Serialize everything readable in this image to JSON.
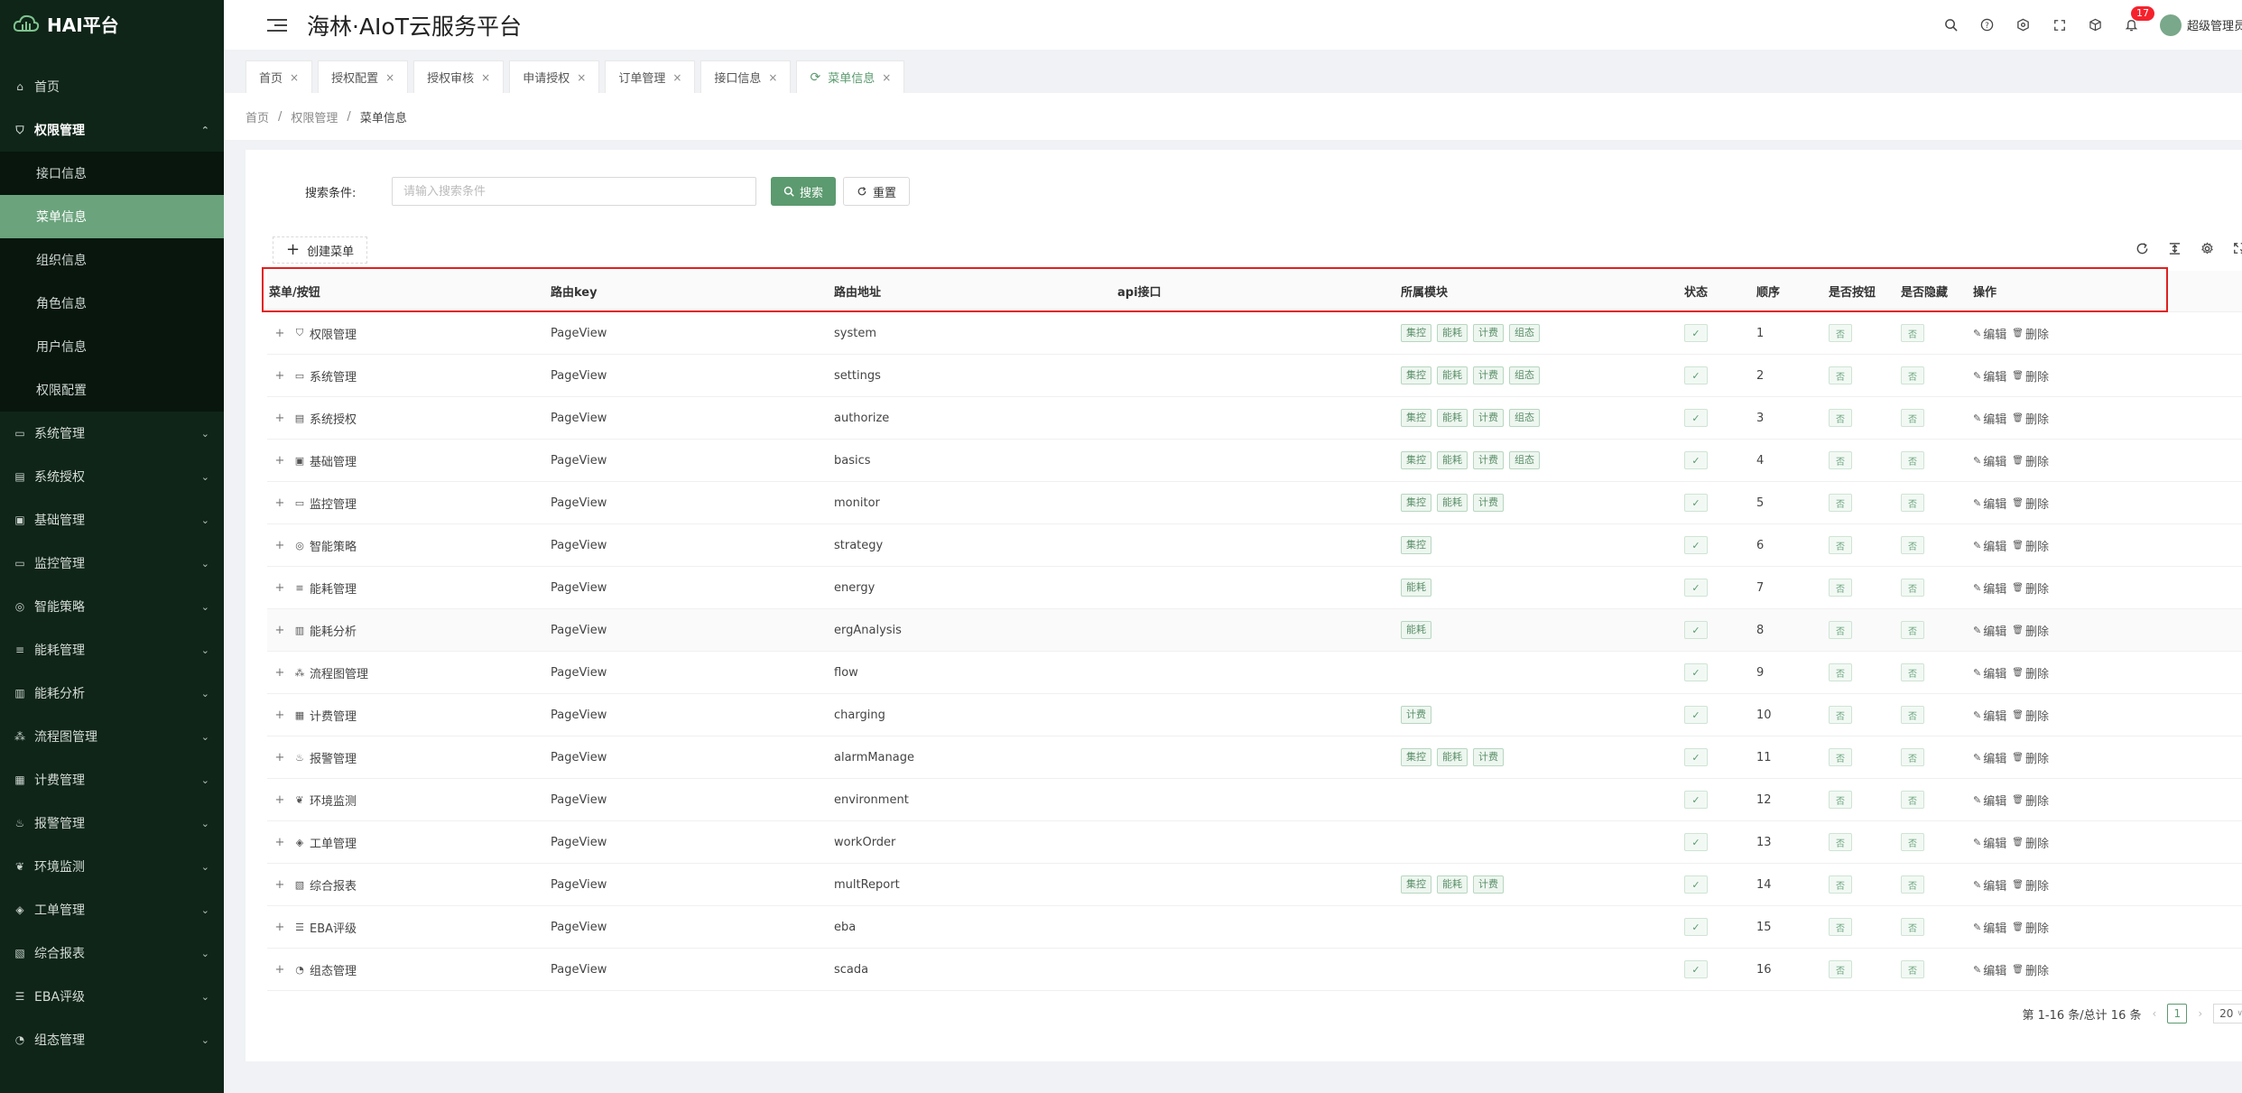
{
  "brand": {
    "title": "HAI平台"
  },
  "header": {
    "title": "海林·AIoT云服务平台",
    "notification_count": "17",
    "user_name": "超级管理员"
  },
  "sidebar": {
    "items": [
      {
        "label": "首页",
        "icon": "home-icon",
        "expandable": false
      },
      {
        "label": "权限管理",
        "icon": "shield-icon",
        "expandable": true,
        "expanded": true,
        "children": [
          {
            "label": "接口信息",
            "selected": false
          },
          {
            "label": "菜单信息",
            "selected": true
          },
          {
            "label": "组织信息",
            "selected": false
          },
          {
            "label": "角色信息",
            "selected": false
          },
          {
            "label": "用户信息",
            "selected": false
          },
          {
            "label": "权限配置",
            "selected": false
          }
        ]
      },
      {
        "label": "系统管理",
        "icon": "monitor-icon",
        "expandable": true
      },
      {
        "label": "系统授权",
        "icon": "document-icon",
        "expandable": true
      },
      {
        "label": "基础管理",
        "icon": "layout-icon",
        "expandable": true
      },
      {
        "label": "监控管理",
        "icon": "monitor-icon",
        "expandable": true
      },
      {
        "label": "智能策略",
        "icon": "bulb-icon",
        "expandable": true
      },
      {
        "label": "能耗管理",
        "icon": "sliders-icon",
        "expandable": true
      },
      {
        "label": "能耗分析",
        "icon": "bar-chart-icon",
        "expandable": true
      },
      {
        "label": "流程图管理",
        "icon": "flow-icon",
        "expandable": true
      },
      {
        "label": "计费管理",
        "icon": "money-icon",
        "expandable": true
      },
      {
        "label": "报警管理",
        "icon": "alarm-icon",
        "expandable": true
      },
      {
        "label": "环境监测",
        "icon": "leaf-icon",
        "expandable": true
      },
      {
        "label": "工单管理",
        "icon": "stack-icon",
        "expandable": true
      },
      {
        "label": "综合报表",
        "icon": "report-icon",
        "expandable": true
      },
      {
        "label": "EBA评级",
        "icon": "list-icon",
        "expandable": true
      },
      {
        "label": "组态管理",
        "icon": "dashboard-icon",
        "expandable": true
      }
    ]
  },
  "tabs": [
    {
      "label": "首页",
      "active": false
    },
    {
      "label": "授权配置",
      "active": false
    },
    {
      "label": "授权审核",
      "active": false
    },
    {
      "label": "申请授权",
      "active": false
    },
    {
      "label": "订单管理",
      "active": false
    },
    {
      "label": "接口信息",
      "active": false
    },
    {
      "label": "菜单信息",
      "active": true
    }
  ],
  "breadcrumb": [
    "首页",
    "权限管理",
    "菜单信息"
  ],
  "search": {
    "label": "搜索条件:",
    "placeholder": "请输入搜索条件",
    "value": "",
    "search_label": "搜索",
    "reset_label": "重置"
  },
  "toolbar": {
    "create_label": "创建菜单"
  },
  "table": {
    "columns": [
      "菜单/按钮",
      "路由key",
      "路由地址",
      "api接口",
      "所属模块",
      "状态",
      "顺序",
      "是否按钮",
      "是否隐藏",
      "操作"
    ],
    "edit_label": "编辑",
    "delete_label": "删除",
    "no_label": "否",
    "status_mark": "✓",
    "rows": [
      {
        "name": "权限管理",
        "icon": "shield-icon",
        "key": "PageView",
        "path": "system",
        "api": "",
        "modules": [
          "集控",
          "能耗",
          "计费",
          "组态"
        ],
        "order": "1"
      },
      {
        "name": "系统管理",
        "icon": "monitor-icon",
        "key": "PageView",
        "path": "settings",
        "api": "",
        "modules": [
          "集控",
          "能耗",
          "计费",
          "组态"
        ],
        "order": "2"
      },
      {
        "name": "系统授权",
        "icon": "document-icon",
        "key": "PageView",
        "path": "authorize",
        "api": "",
        "modules": [
          "集控",
          "能耗",
          "计费",
          "组态"
        ],
        "order": "3"
      },
      {
        "name": "基础管理",
        "icon": "layout-icon",
        "key": "PageView",
        "path": "basics",
        "api": "",
        "modules": [
          "集控",
          "能耗",
          "计费",
          "组态"
        ],
        "order": "4"
      },
      {
        "name": "监控管理",
        "icon": "monitor-icon",
        "key": "PageView",
        "path": "monitor",
        "api": "",
        "modules": [
          "集控",
          "能耗",
          "计费"
        ],
        "order": "5"
      },
      {
        "name": "智能策略",
        "icon": "bulb-icon",
        "key": "PageView",
        "path": "strategy",
        "api": "",
        "modules": [
          "集控"
        ],
        "order": "6"
      },
      {
        "name": "能耗管理",
        "icon": "sliders-icon",
        "key": "PageView",
        "path": "energy",
        "api": "",
        "modules": [
          "能耗"
        ],
        "order": "7"
      },
      {
        "name": "能耗分析",
        "icon": "bar-chart-icon",
        "key": "PageView",
        "path": "ergAnalysis",
        "api": "",
        "modules": [
          "能耗"
        ],
        "order": "8"
      },
      {
        "name": "流程图管理",
        "icon": "flow-icon",
        "key": "PageView",
        "path": "flow",
        "api": "",
        "modules": [],
        "order": "9"
      },
      {
        "name": "计费管理",
        "icon": "money-icon",
        "key": "PageView",
        "path": "charging",
        "api": "",
        "modules": [
          "计费"
        ],
        "order": "10"
      },
      {
        "name": "报警管理",
        "icon": "alarm-icon",
        "key": "PageView",
        "path": "alarmManage",
        "api": "",
        "modules": [
          "集控",
          "能耗",
          "计费"
        ],
        "order": "11"
      },
      {
        "name": "环境监测",
        "icon": "leaf-icon",
        "key": "PageView",
        "path": "environment",
        "api": "",
        "modules": [],
        "order": "12"
      },
      {
        "name": "工单管理",
        "icon": "stack-icon",
        "key": "PageView",
        "path": "workOrder",
        "api": "",
        "modules": [],
        "order": "13"
      },
      {
        "name": "综合报表",
        "icon": "report-icon",
        "key": "PageView",
        "path": "multReport",
        "api": "",
        "modules": [
          "集控",
          "能耗",
          "计费"
        ],
        "order": "14"
      },
      {
        "name": "EBA评级",
        "icon": "list-icon",
        "key": "PageView",
        "path": "eba",
        "api": "",
        "modules": [],
        "order": "15"
      },
      {
        "name": "组态管理",
        "icon": "dashboard-icon",
        "key": "PageView",
        "path": "scada",
        "api": "",
        "modules": [],
        "order": "16"
      }
    ]
  },
  "pagination": {
    "summary": "第 1-16 条/总计 16 条",
    "current_page": "1",
    "page_size": "20"
  },
  "colors": {
    "sidebar_bg": "#0f2518",
    "accent": "#5c9a6f",
    "selected_menu": "#6aa37c",
    "highlight_border": "#e02020",
    "badge": "#f5222d"
  }
}
